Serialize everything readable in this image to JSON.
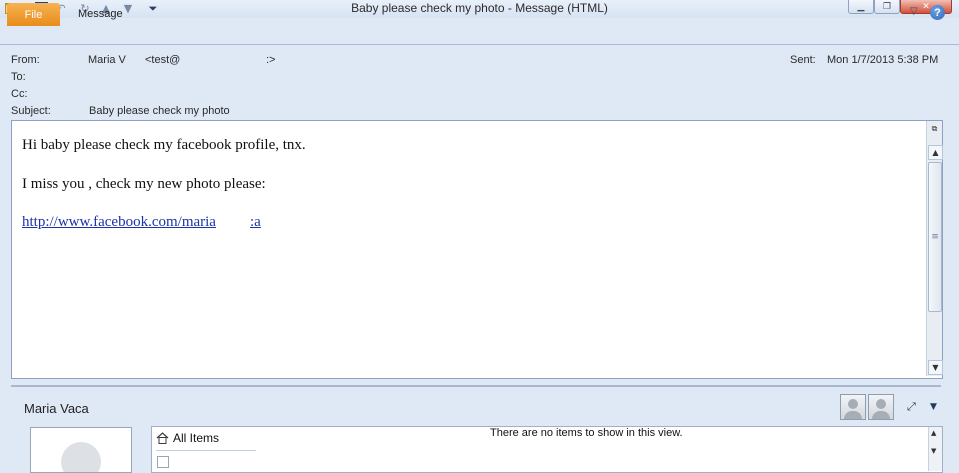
{
  "window": {
    "title": "Baby please check my photo  -  Message (HTML)"
  },
  "ribbon": {
    "file_tab": "File",
    "message_tab": "Message",
    "help_label": "?"
  },
  "header": {
    "from_label": "From:",
    "from_name": "Maria V",
    "from_email": "<test@",
    "from_email_end": ":>",
    "to_label": "To:",
    "cc_label": "Cc:",
    "subject_label": "Subject:",
    "subject_value": "Baby please check my photo",
    "sent_label": "Sent:",
    "sent_value": "Mon 1/7/2013 5:38 PM"
  },
  "message": {
    "line1": "Hi baby please check my facebook profile, tnx.",
    "line2": "I miss you , check my new photo please:",
    "link_part1": "http://www.facebook.com/maria",
    "link_part2": ":a"
  },
  "people_pane": {
    "contact_name": "Maria Vaca",
    "all_items_label": "All Items",
    "no_items_text": "There are no items to show in this view."
  }
}
